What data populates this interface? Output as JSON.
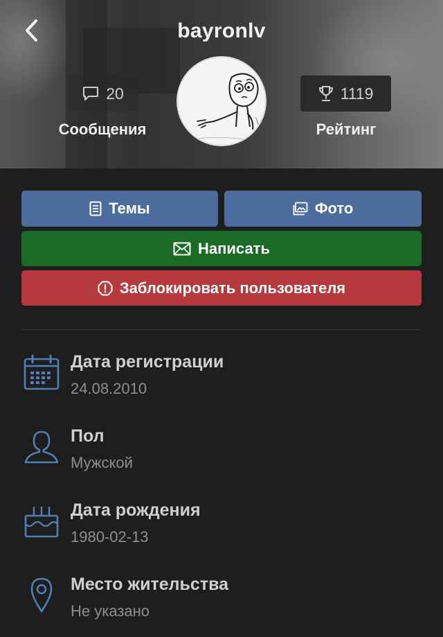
{
  "header": {
    "username": "bayronlv",
    "messages_count": "20",
    "messages_label": "Сообщения",
    "rating_value": "1119",
    "rating_label": "Рейтинг"
  },
  "actions": {
    "topics_label": "Темы",
    "photos_label": "Фото",
    "write_label": "Написать",
    "block_label": "Заблокировать пользователя"
  },
  "info": [
    {
      "title": "Дата регистрации",
      "value": "24.08.2010",
      "icon": "calendar-icon"
    },
    {
      "title": "Пол",
      "value": "Мужской",
      "icon": "person-icon"
    },
    {
      "title": "Дата рождения",
      "value": "1980-02-13",
      "icon": "birthday-cake-icon"
    },
    {
      "title": "Место жительства",
      "value": "Не указано",
      "icon": "location-pin-icon"
    }
  ],
  "colors": {
    "background": "#1e1e1e",
    "primary_button": "#4c6c9d",
    "write_button": "#1b6a25",
    "block_button": "#b63a3d",
    "icon_accent": "#4f7fb4"
  }
}
